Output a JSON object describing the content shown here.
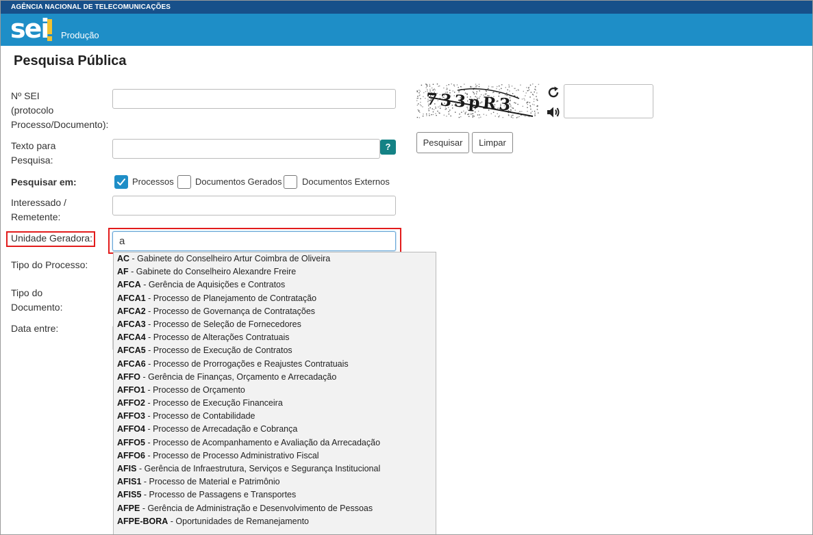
{
  "header": {
    "agency": "AGÊNCIA NACIONAL DE TELECOMUNICAÇÕES",
    "logo": "sei",
    "environment": "Produção"
  },
  "page_title": "Pesquisa Pública",
  "form": {
    "nsei_label_lines": [
      "Nº SEI",
      "(protocolo",
      "Processo/Documento):"
    ],
    "texto_label_lines": [
      "Texto para",
      "Pesquisa:"
    ],
    "help_label": "?",
    "pesquisar_em_label": "Pesquisar em:",
    "checkboxes": [
      {
        "label": "Processos",
        "checked": true
      },
      {
        "label": "Documentos Gerados",
        "checked": false
      },
      {
        "label": "Documentos Externos",
        "checked": false
      }
    ],
    "interessado_label_lines": [
      "Interessado /",
      "Remetente:"
    ],
    "unidade_label": "Unidade Geradora:",
    "unidade_value": "a",
    "tipo_processo_label": "Tipo do Processo:",
    "tipo_documento_label_lines": [
      "Tipo do",
      "Documento:"
    ],
    "data_label": "Data entre:"
  },
  "captcha": {
    "text": "733pR3",
    "refresh_icon": "refresh-icon",
    "audio_icon": "speaker-icon"
  },
  "buttons": {
    "search": "Pesquisar",
    "clear": "Limpar"
  },
  "dropdown": {
    "items": [
      {
        "code": "AC",
        "name": "Gabinete do Conselheiro Artur Coimbra de Oliveira"
      },
      {
        "code": "AF",
        "name": "Gabinete do Conselheiro Alexandre Freire"
      },
      {
        "code": "AFCA",
        "name": "Gerência de Aquisições e Contratos"
      },
      {
        "code": "AFCA1",
        "name": "Processo de Planejamento de Contratação"
      },
      {
        "code": "AFCA2",
        "name": "Processo de Governança de Contratações"
      },
      {
        "code": "AFCA3",
        "name": "Processo de Seleção de Fornecedores"
      },
      {
        "code": "AFCA4",
        "name": "Processo de Alterações Contratuais"
      },
      {
        "code": "AFCA5",
        "name": "Processo de Execução de Contratos"
      },
      {
        "code": "AFCA6",
        "name": "Processo de Prorrogações e Reajustes Contratuais"
      },
      {
        "code": "AFFO",
        "name": "Gerência de Finanças, Orçamento e Arrecadação"
      },
      {
        "code": "AFFO1",
        "name": "Processo de Orçamento"
      },
      {
        "code": "AFFO2",
        "name": "Processo de Execução Financeira"
      },
      {
        "code": "AFFO3",
        "name": "Processo de Contabilidade"
      },
      {
        "code": "AFFO4",
        "name": "Processo de Arrecadação e Cobrança"
      },
      {
        "code": "AFFO5",
        "name": "Processo de Acompanhamento e Avaliação da Arrecadação"
      },
      {
        "code": "AFFO6",
        "name": "Processo de Processo Administrativo Fiscal"
      },
      {
        "code": "AFIS",
        "name": "Gerência de Infraestrutura, Serviços e Segurança Institucional"
      },
      {
        "code": "AFIS1",
        "name": "Processo de Material e Patrimônio"
      },
      {
        "code": "AFIS5",
        "name": "Processo de Passagens e Transportes"
      },
      {
        "code": "AFPE",
        "name": "Gerência de Administração e Desenvolvimento de Pessoas"
      },
      {
        "code": "AFPE-BORA",
        "name": "Oportunidades de Remanejamento"
      }
    ]
  },
  "colors": {
    "topbar": "#17508a",
    "brandbar": "#1e8ec7",
    "logo_accent": "#f2c230",
    "help_button": "#148285",
    "highlight": "#e21b1b"
  }
}
